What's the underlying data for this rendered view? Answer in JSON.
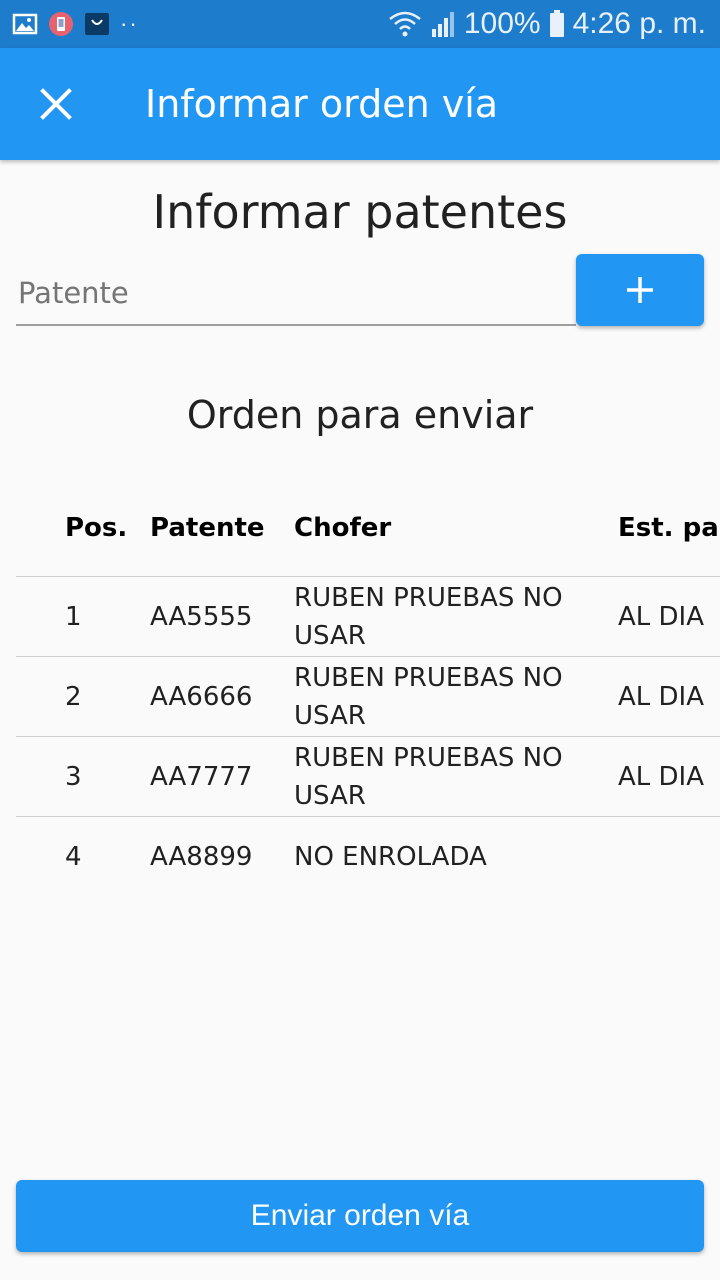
{
  "status_bar": {
    "battery_text": "100%",
    "time": "4:26 p. m.",
    "dots": "··"
  },
  "app_bar": {
    "title": "Informar orden vía",
    "close_icon": "close-icon"
  },
  "form": {
    "title": "Informar patentes",
    "patente_placeholder": "Patente",
    "patente_value": "",
    "add_icon": "plus-icon"
  },
  "order": {
    "title": "Orden para enviar",
    "columns": [
      "Pos.",
      "Patente",
      "Chofer",
      "Est. pa"
    ],
    "rows": [
      {
        "pos": "1",
        "patente": "AA5555",
        "chofer": "RUBEN PRUEBAS NO USAR",
        "estado": "AL DIA"
      },
      {
        "pos": "2",
        "patente": "AA6666",
        "chofer": "RUBEN PRUEBAS NO USAR",
        "estado": "AL DIA"
      },
      {
        "pos": "3",
        "patente": "AA7777",
        "chofer": "RUBEN PRUEBAS NO USAR",
        "estado": "AL DIA"
      },
      {
        "pos": "4",
        "patente": "AA8899",
        "chofer": "NO ENROLADA",
        "estado": ""
      }
    ]
  },
  "actions": {
    "send_label": "Enviar orden vía"
  },
  "colors": {
    "primary": "#2196f3",
    "status_bar": "#1e7ccc"
  }
}
